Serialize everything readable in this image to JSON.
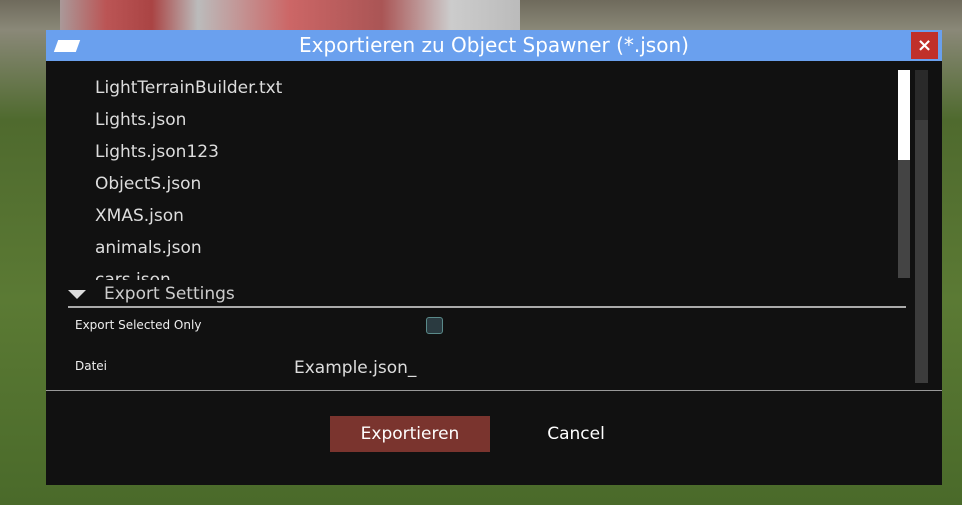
{
  "title": "Exportieren zu Object Spawner (*.json)",
  "close": "×",
  "files": [
    "LightTerrainBuilder.txt",
    "Lights.json",
    "Lights.json123",
    "ObjectS.json",
    "XMAS.json",
    "animals.json",
    "cars.json"
  ],
  "section": "Export Settings",
  "settings": {
    "export_selected_label": "Export Selected Only",
    "export_selected_checked": false,
    "file_label": "Datei",
    "file_value": "Example.json_"
  },
  "buttons": {
    "ok": "Exportieren",
    "cancel": "Cancel"
  }
}
